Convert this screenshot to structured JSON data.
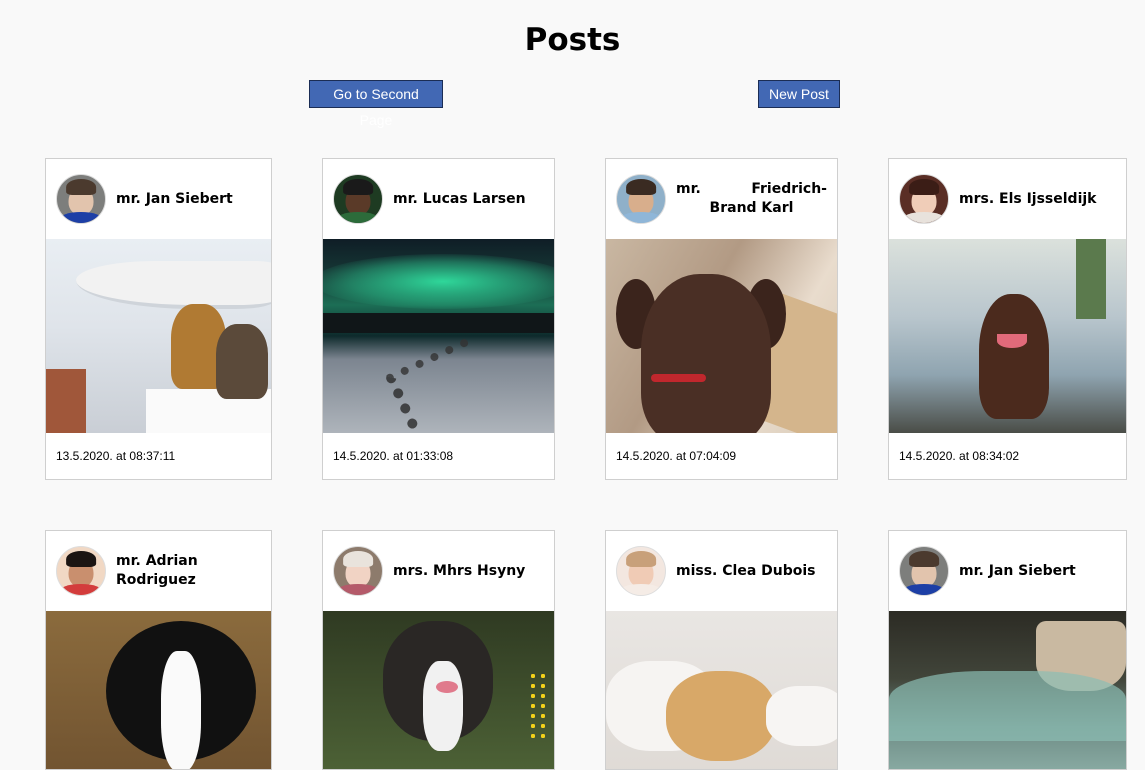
{
  "page": {
    "title": "Posts"
  },
  "buttons": {
    "second_page": "Go to Second Page",
    "new_post": "New Post"
  },
  "colors": {
    "button_bg": "#4268b4",
    "page_bg": "#f9f9f9"
  },
  "posts": [
    {
      "author": "mr. Jan Siebert",
      "date": "13.5.2020. at 08:37:11",
      "image": "dogs-on-boat"
    },
    {
      "author": "mr. Lucas Larsen",
      "date": "14.5.2020. at 01:33:08",
      "image": "aurora-sled-dogs"
    },
    {
      "author": "mr. Friedrich- Brand Karl",
      "date": "14.5.2020. at 07:04:09",
      "image": "chocolate-labrador"
    },
    {
      "author": "mrs. Els Ijsseldijk",
      "date": "14.5.2020. at 08:34:02",
      "image": "brown-dog-running"
    },
    {
      "author": "mr. Adrian Rodriguez",
      "image": "border-collie-puppy"
    },
    {
      "author": "mrs. Mhrs Hsyny",
      "image": "tricolor-collie"
    },
    {
      "author": "miss. Clea Dubois",
      "image": "spaniel-on-pillow"
    },
    {
      "author": "mr. Jan Siebert",
      "image": "dog-in-fountain"
    }
  ]
}
